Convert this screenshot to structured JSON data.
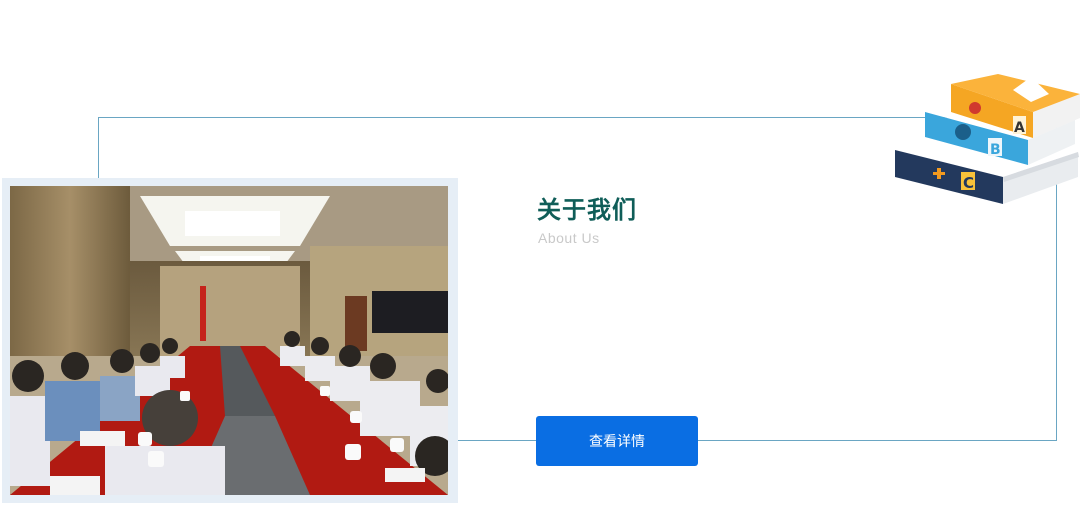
{
  "about": {
    "title": "关于我们",
    "subtitle": "About  Us",
    "button_label": "查看详情"
  },
  "books_illustration": {
    "letters": [
      "A",
      "B",
      "C"
    ]
  },
  "colors": {
    "title": "#0f5d58",
    "subtitle": "#c9c9c9",
    "button": "#0a6ee3",
    "frame_border": "#6aa6c3"
  }
}
